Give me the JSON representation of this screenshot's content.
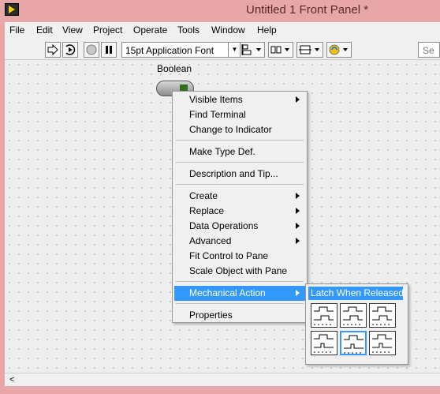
{
  "window": {
    "title": "Untitled 1 Front Panel *"
  },
  "menubar": {
    "items": [
      "File",
      "Edit",
      "View",
      "Project",
      "Operate",
      "Tools",
      "Window",
      "Help"
    ]
  },
  "toolbar": {
    "run_icon": "run-arrow-icon",
    "run_continuously_icon": "run-continuously-icon",
    "abort_icon": "abort-stop-icon",
    "pause_icon": "pause-icon",
    "font_value": "15pt Application Font",
    "align_icon": "align-objects-icon",
    "distribute_icon": "distribute-objects-icon",
    "resize_icon": "resize-objects-icon",
    "reorder_icon": "reorder-icon",
    "search_placeholder": "Se"
  },
  "canvas": {
    "control_label": "Boolean"
  },
  "context_menu": {
    "items": [
      "Visible Items",
      "Find Terminal",
      "Change to Indicator",
      "Make Type Def.",
      "Description and Tip...",
      "Create",
      "Replace",
      "Data Operations",
      "Advanced",
      "Fit Control to Pane",
      "Scale Object with Pane",
      "Mechanical Action",
      "Properties"
    ],
    "highlighted": "Mechanical Action"
  },
  "submenu": {
    "title": "Latch When Released",
    "options": [
      "switch-when-pressed",
      "switch-when-released",
      "switch-until-released",
      "latch-when-pressed",
      "latch-when-released",
      "latch-until-released"
    ],
    "selected_index": 4
  },
  "colors": {
    "highlight": "#3399ff",
    "titlebar": "#e8a6a8",
    "led": "#2f6f1e"
  }
}
